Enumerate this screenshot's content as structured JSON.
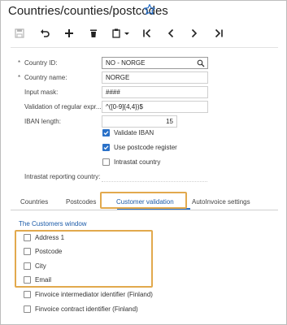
{
  "page": {
    "title": "Countries/counties/postcodes"
  },
  "toolbar": {
    "buttons": [
      {
        "name": "save-icon"
      },
      {
        "name": "undo-icon"
      },
      {
        "name": "add-icon"
      },
      {
        "name": "delete-icon"
      },
      {
        "name": "copy-paste-icon"
      },
      {
        "name": "first-record-icon"
      },
      {
        "name": "previous-record-icon"
      },
      {
        "name": "next-record-icon"
      },
      {
        "name": "last-record-icon"
      }
    ]
  },
  "form": {
    "required_mark": "*",
    "country_id": {
      "label": "Country ID:",
      "value": "NO - NORGE"
    },
    "country_name": {
      "label": "Country name:",
      "value": "NORGE"
    },
    "input_mask": {
      "label": "Input mask:",
      "value": "####"
    },
    "validation_regex": {
      "label": "Validation of regular expr...",
      "value": "^([0-9]{4,4})$"
    },
    "iban_length": {
      "label": "IBAN length:",
      "value": "15"
    },
    "validate_iban": {
      "label": "Validate IBAN",
      "checked": true
    },
    "use_postcode_register": {
      "label": "Use postcode register",
      "checked": true
    },
    "intrastat_country": {
      "label": "Intrastat country",
      "checked": false
    },
    "intrastat_reporting_country": {
      "label": "Intrastat reporting country:",
      "value": ""
    }
  },
  "tabs": [
    {
      "label": "Countries",
      "active": false
    },
    {
      "label": "Postcodes",
      "active": false
    },
    {
      "label": "Customer validation",
      "active": true
    },
    {
      "label": "AutoInvoice settings",
      "active": false
    }
  ],
  "customer_validation": {
    "section_title": "The Customers window",
    "items": [
      {
        "label": "Address 1",
        "checked": false
      },
      {
        "label": "Postcode",
        "checked": false
      },
      {
        "label": "City",
        "checked": false
      },
      {
        "label": "Email",
        "checked": false
      },
      {
        "label": "Finvoice intermediator identifier (Finland)",
        "checked": false
      },
      {
        "label": "Finvoice contract identifier (Finland)",
        "checked": false
      }
    ]
  },
  "colors": {
    "accent": "#2a71c8",
    "highlight": "#e2a94d",
    "link": "#1a5aa8"
  }
}
